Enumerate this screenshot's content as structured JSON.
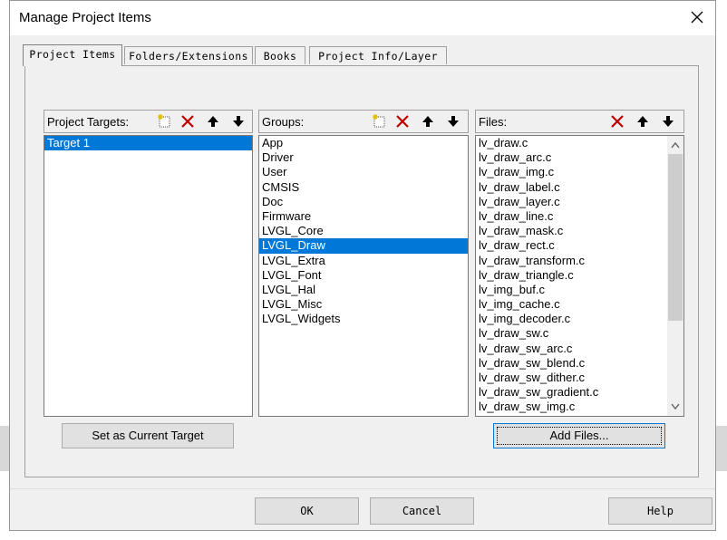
{
  "window": {
    "title": "Manage Project Items"
  },
  "tabs": [
    {
      "label": "Project Items",
      "active": true
    },
    {
      "label": "Folders/Extensions",
      "active": false
    },
    {
      "label": "Books",
      "active": false
    },
    {
      "label": "Project Info/Layer",
      "active": false
    }
  ],
  "targets": {
    "header": "Project Targets:",
    "items": [
      "Target 1"
    ],
    "selected": "Target 1"
  },
  "groups": {
    "header": "Groups:",
    "items": [
      "App",
      "Driver",
      "User",
      "CMSIS",
      "Doc",
      "Firmware",
      "LVGL_Core",
      "LVGL_Draw",
      "LVGL_Extra",
      "LVGL_Font",
      "LVGL_Hal",
      "LVGL_Misc",
      "LVGL_Widgets"
    ],
    "selected": "LVGL_Draw"
  },
  "files": {
    "header": "Files:",
    "items": [
      "lv_draw.c",
      "lv_draw_arc.c",
      "lv_draw_img.c",
      "lv_draw_label.c",
      "lv_draw_layer.c",
      "lv_draw_line.c",
      "lv_draw_mask.c",
      "lv_draw_rect.c",
      "lv_draw_transform.c",
      "lv_draw_triangle.c",
      "lv_img_buf.c",
      "lv_img_cache.c",
      "lv_img_decoder.c",
      "lv_draw_sw.c",
      "lv_draw_sw_arc.c",
      "lv_draw_sw_blend.c",
      "lv_draw_sw_dither.c",
      "lv_draw_sw_gradient.c",
      "lv_draw_sw_img.c"
    ]
  },
  "buttons": {
    "set_target": "Set as Current Target",
    "add_files": "Add Files...",
    "ok": "OK",
    "cancel": "Cancel",
    "help": "Help"
  },
  "colors": {
    "selection": "#0078d7",
    "delete_icon": "#c00000",
    "new_icon": "#e0c000"
  }
}
